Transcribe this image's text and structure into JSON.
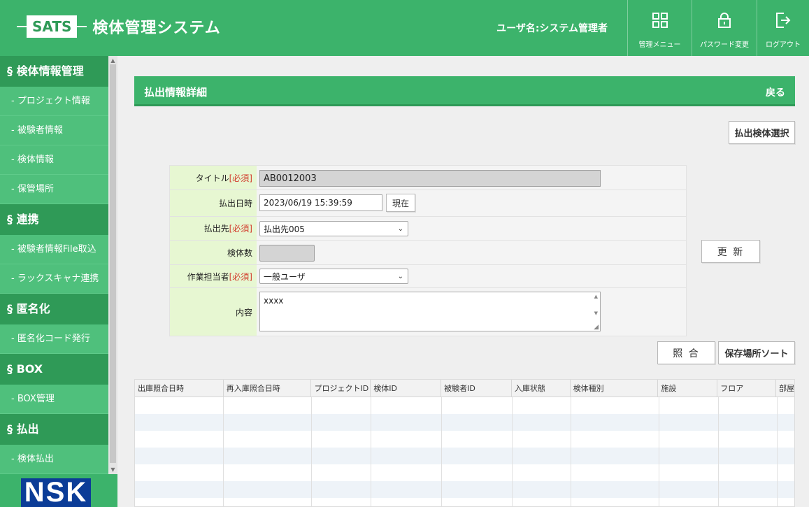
{
  "header": {
    "logo_text": "SATS",
    "app_title": "検体管理システム",
    "user_label": "ユーザ名:システム管理者",
    "buttons": [
      {
        "label": "管理メニュー",
        "icon": "grid-icon"
      },
      {
        "label": "パスワード変更",
        "icon": "lock-icon"
      },
      {
        "label": "ログアウト",
        "icon": "logout-icon"
      }
    ]
  },
  "sidebar": {
    "sections": [
      {
        "title": "§ 検体情報管理",
        "items": [
          "- プロジェクト情報",
          "- 被験者情報",
          "- 検体情報",
          "- 保管場所"
        ]
      },
      {
        "title": "§ 連携",
        "items": [
          "- 被験者情報File取込",
          "- ラックスキャナ連携"
        ]
      },
      {
        "title": "§ 匿名化",
        "items": [
          "- 匿名化コード発行"
        ]
      },
      {
        "title": "§ BOX",
        "items": [
          "- BOX管理"
        ]
      },
      {
        "title": "§ 払出",
        "items": [
          "- 検体払出"
        ]
      }
    ],
    "brand": "NSK"
  },
  "page": {
    "title": "払出情報詳細",
    "back": "戻る",
    "select_specimen_button": "払出検体選択",
    "update_button": "更 新",
    "match_button": "照 合",
    "sort_button": "保存場所ソート"
  },
  "form": {
    "required_mark": "[必須]",
    "title_label": "タイトル",
    "title_value": "AB0012003",
    "date_label": "払出日時",
    "date_value": "2023/06/19 15:39:59",
    "now_button": "現在",
    "dest_label": "払出先",
    "dest_value": "払出先005",
    "count_label": "検体数",
    "count_value": "",
    "worker_label": "作業担当者",
    "worker_value": "一般ユーザ",
    "content_label": "内容",
    "content_value": "xxxx"
  },
  "table": {
    "columns": [
      "出庫照合日時",
      "再入庫照合日時",
      "プロジェクトID",
      "検体ID",
      "被験者ID",
      "入庫状態",
      "検体種別",
      "施設",
      "フロア",
      "部屋"
    ]
  }
}
